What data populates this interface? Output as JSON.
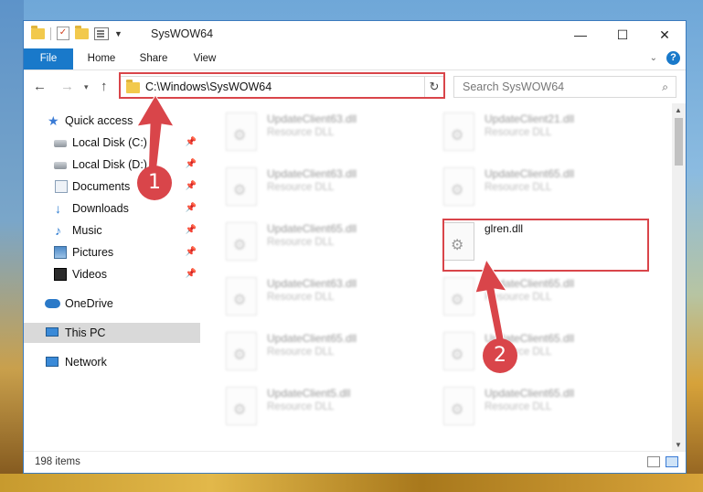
{
  "window": {
    "title": "SysWOW64",
    "minimize": "—",
    "maximize": "☐",
    "close": "✕"
  },
  "ribbon": {
    "tabs": [
      "File",
      "Home",
      "Share",
      "View"
    ],
    "help": "?"
  },
  "address": {
    "path": "C:\\Windows\\SysWOW64",
    "search_placeholder": "Search SysWOW64"
  },
  "sidebar": {
    "items": [
      {
        "label": "Quick access",
        "icon": "star-icon"
      },
      {
        "label": "Local Disk (C:)",
        "icon": "disk-icon",
        "pinned": true
      },
      {
        "label": "Local Disk (D:)",
        "icon": "disk-icon",
        "pinned": true
      },
      {
        "label": "Documents",
        "icon": "documents-icon",
        "pinned": true
      },
      {
        "label": "Downloads",
        "icon": "download-icon",
        "pinned": true
      },
      {
        "label": "Music",
        "icon": "music-icon",
        "pinned": true
      },
      {
        "label": "Pictures",
        "icon": "pictures-icon",
        "pinned": true
      },
      {
        "label": "Videos",
        "icon": "videos-icon",
        "pinned": true
      },
      {
        "label": "OneDrive",
        "icon": "cloud-icon"
      },
      {
        "label": "This PC",
        "icon": "computer-icon",
        "selected": true
      },
      {
        "label": "Network",
        "icon": "network-icon"
      }
    ]
  },
  "files": [
    {
      "name": "UpdateClient63.dll",
      "type": "Resource DLL"
    },
    {
      "name": "UpdateClient21.dll",
      "type": "Resource DLL"
    },
    {
      "name": "UpdateClient63.dll",
      "type": "Resource DLL"
    },
    {
      "name": "UpdateClient65.dll",
      "type": "Resource DLL"
    },
    {
      "name": "UpdateClient65.dll",
      "type": "Resource DLL"
    },
    {
      "name": "glren.dll",
      "type": ""
    },
    {
      "name": "UpdateClient63.dll",
      "type": "Resource DLL"
    },
    {
      "name": "UpdateClient65.dll",
      "type": "Resource DLL"
    },
    {
      "name": "UpdateClient65.dll",
      "type": "Resource DLL"
    },
    {
      "name": "UpdateClient65.dll",
      "type": "Resource DLL"
    },
    {
      "name": "UpdateClient5.dll",
      "type": "Resource DLL"
    },
    {
      "name": "UpdateClient65.dll",
      "type": "Resource DLL"
    }
  ],
  "status": {
    "item_count": "198 items"
  },
  "annotations": {
    "step1": "1",
    "step2": "2",
    "highlight_color": "#d9454a"
  }
}
